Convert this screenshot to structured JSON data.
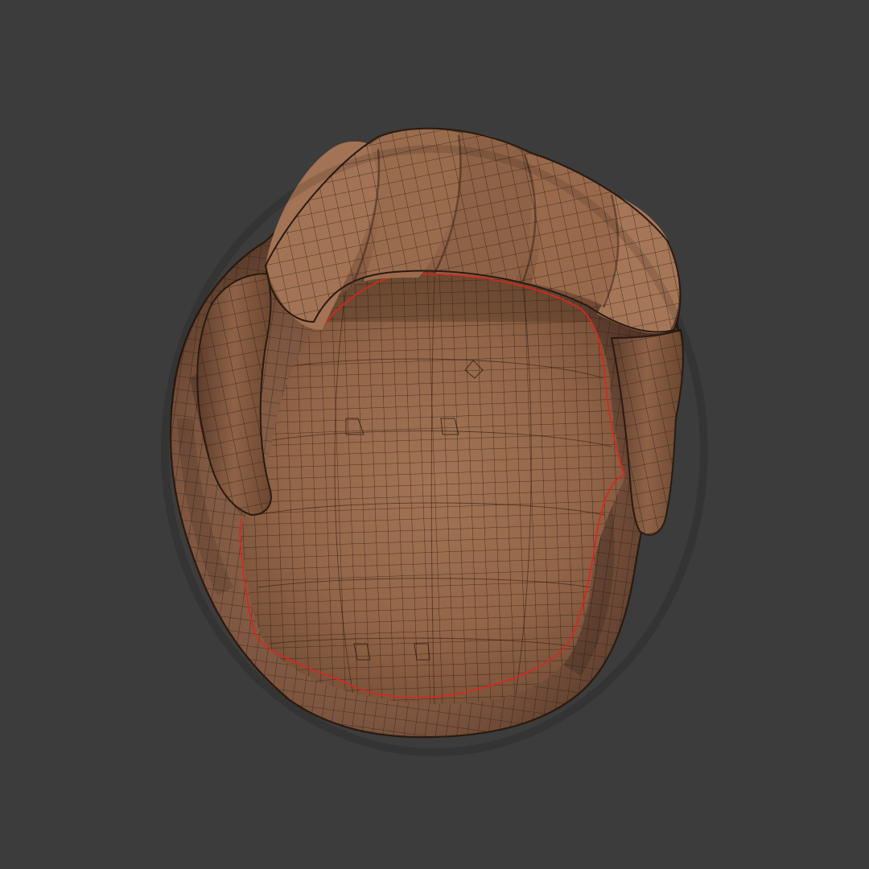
{
  "viewport": {
    "background_color": "#3c3c3c"
  },
  "model": {
    "subject": "hair-mesh",
    "wire_color": "#1f120b",
    "seam_color": "#e0241c",
    "palette": {
      "light": "#a87a5a",
      "mid": "#8c6146",
      "dark": "#5a3a28",
      "deep": "#3d271b"
    }
  }
}
